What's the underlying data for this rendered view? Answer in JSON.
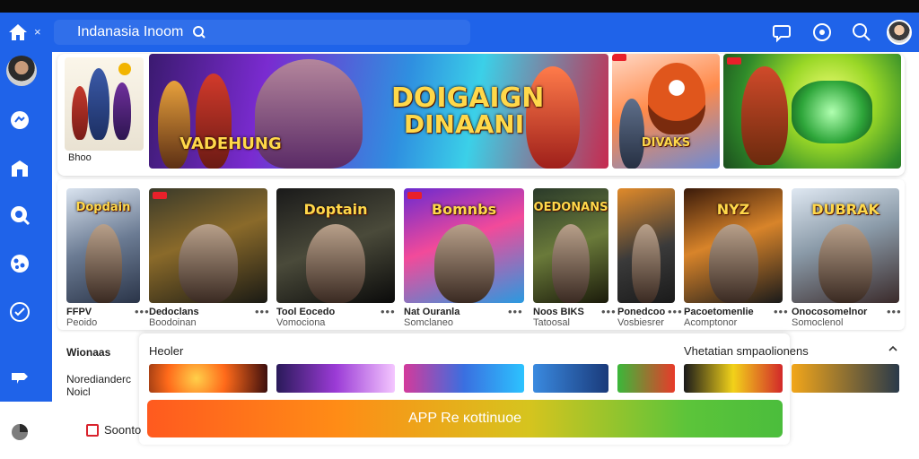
{
  "header": {
    "search_value": "Indanasia Inoom",
    "close_glyph": "×",
    "icons": [
      "home-icon",
      "close-icon",
      "search-icon",
      "chat-icon",
      "compass-icon",
      "search-icon",
      "avatar"
    ]
  },
  "sidebar": {
    "icons": [
      "avatar",
      "chat-icon",
      "store-icon",
      "search-icon",
      "globe-icon",
      "check-icon",
      "cloud-icon",
      "pie-chart-icon"
    ]
  },
  "featured": {
    "left_tile_label": "Bhoo",
    "hero_title_line1": "DOIGAIGN",
    "hero_title_line2": "DINAANI",
    "hero_sub": "VADEHUNG",
    "tile_caption": "DIVAKS"
  },
  "games": [
    {
      "title": "FFPV",
      "sub": "Peoido",
      "art": "Dopdain"
    },
    {
      "title": "Dedoclans",
      "sub": "Boodoinan",
      "art": ""
    },
    {
      "title": "Tool Eocedo",
      "sub": "Vomociona",
      "art": "Doptain"
    },
    {
      "title": "Nat Ouranla",
      "sub": "Somclaneo",
      "art": "Bomnbs"
    },
    {
      "title": "Noos BIKS",
      "sub": "Tatoosal",
      "art": "OEDONANS"
    },
    {
      "title": "Ponedcoo",
      "sub": "Vosbiesrer",
      "art": ""
    },
    {
      "title": "Pacoetomenlie",
      "sub": "Acomptonor",
      "art": "NYZ"
    },
    {
      "title": "Onocosomelnor",
      "sub": "Somoclenol",
      "art": "DUBRAK"
    }
  ],
  "lower_section": {
    "left_heading": "Wionaas",
    "left_item": "Noredianderc",
    "left_item_sub": "Noicl",
    "sheet_heading": "Heoler",
    "right_heading": "Vhetatian smpaolionens",
    "cta_label": "APP Re ĸottinuoe",
    "source_label": "Soonto"
  },
  "colors": {
    "brand_blue": "#1f63e9",
    "badge_red": "#e8202a",
    "cta_start": "#ff5a1f",
    "cta_end": "#4bbd3c"
  }
}
